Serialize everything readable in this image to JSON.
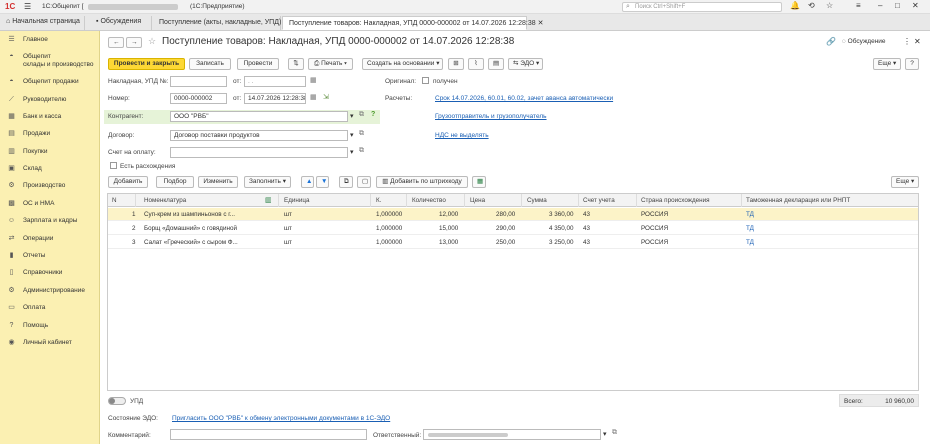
{
  "titlebar": {
    "app_title": "1С:Общепит [",
    "app_suffix": "(1С:Предприятие)",
    "search_placeholder": "Поиск Ctrl+Shift+F"
  },
  "tabs": [
    {
      "label": "Начальная страница"
    },
    {
      "label": "Обсуждения"
    },
    {
      "label": "Поступление (акты, накладные, УПД)"
    },
    {
      "label": "Поступление товаров: Накладная, УПД 0000-000002 от 14.07.2026 12:28:38"
    }
  ],
  "sidebar": {
    "items": [
      {
        "label": "Главное"
      },
      {
        "label": "Общепит",
        "label2": "склады и производство"
      },
      {
        "label": "Общепит продажи"
      },
      {
        "label": "Руководителю"
      },
      {
        "label": "Банк и касса"
      },
      {
        "label": "Продажи"
      },
      {
        "label": "Покупки"
      },
      {
        "label": "Склад"
      },
      {
        "label": "Производство"
      },
      {
        "label": "ОС и НМА"
      },
      {
        "label": "Зарплата и кадры"
      },
      {
        "label": "Операции"
      },
      {
        "label": "Отчеты"
      },
      {
        "label": "Справочники"
      },
      {
        "label": "Администрирование"
      },
      {
        "label": "Оплата"
      },
      {
        "label": "Помощь"
      },
      {
        "label": "Личный кабинет"
      }
    ]
  },
  "document": {
    "title": "Поступление товаров: Накладная, УПД 0000-000002 от 14.07.2026 12:28:38",
    "discussion": "Обсуждение",
    "more": "Еще"
  },
  "toolbar": {
    "post_close": "Провести и закрыть",
    "save": "Записать",
    "post": "Провести",
    "print": "Печать",
    "create_based": "Создать на основании",
    "edo": "ЭДО"
  },
  "form": {
    "invoice_label": "Накладная, УПД №:",
    "invoice_value": "",
    "from_label": "от:",
    "from_value": ". .",
    "number_label": "Номер:",
    "number_value": "0000-000002",
    "date_value": "14.07.2026 12:28:38",
    "original_label": "Оригинал:",
    "received_label": "получен",
    "payments_label": "Расчеты:",
    "payments_link": "Срок 14.07.2026, 60.01, 60.02, зачет аванса автоматически",
    "shipper_link": "Грузоотправитель и грузополучатель",
    "vat_link": "НДС не выделять",
    "counterparty_label": "Контрагент:",
    "counterparty_value": "ООО \"РВБ\"",
    "contract_label": "Договор:",
    "contract_value": "Договор поставки продуктов",
    "invoice_pay_label": "Счет на оплату:",
    "discrepancy_label": "Есть расхождения"
  },
  "table_toolbar": {
    "add": "Добавить",
    "select": "Подбор",
    "change": "Изменить",
    "fill": "Заполнить",
    "barcode": "Добавить по штрихкоду",
    "more": "Еще"
  },
  "table": {
    "headers": [
      "N",
      "Номенклатура",
      "Единица",
      "К.",
      "Количество",
      "Цена",
      "Сумма",
      "Счет учета",
      "Страна происхождения",
      "Таможенная декларация или РНПТ"
    ],
    "rows": [
      {
        "n": "1",
        "name": "Суп-крем из шампиньонов с г...",
        "unit": "шт",
        "k": "1,000000",
        "qty": "12,000",
        "price": "280,00",
        "sum": "3 360,00",
        "account": "43",
        "country": "РОССИЯ",
        "decl": "ТД"
      },
      {
        "n": "2",
        "name": "Борщ «Домашний» с говядиной",
        "unit": "шт",
        "k": "1,000000",
        "qty": "15,000",
        "price": "290,00",
        "sum": "4 350,00",
        "account": "43",
        "country": "РОССИЯ",
        "decl": "ТД"
      },
      {
        "n": "3",
        "name": "Салат «Греческий» с сыром Ф...",
        "unit": "шт",
        "k": "1,000000",
        "qty": "13,000",
        "price": "250,00",
        "sum": "3 250,00",
        "account": "43",
        "country": "РОССИЯ",
        "decl": "ТД"
      }
    ]
  },
  "footer": {
    "upd_label": "УПД",
    "edo_state_label": "Состояние ЭДО:",
    "edo_state_link": "Пригласить ООО \"РВБ\" к обмену электронными документами в 1С-ЭДО",
    "comment_label": "Комментарий:",
    "responsible_label": "Ответственный:",
    "total_label": "Всего:",
    "total_value": "10 960,00"
  },
  "colors": {
    "accent": "#fdd835",
    "sidebar": "#fbf0b2",
    "link": "#1a5fb4"
  }
}
